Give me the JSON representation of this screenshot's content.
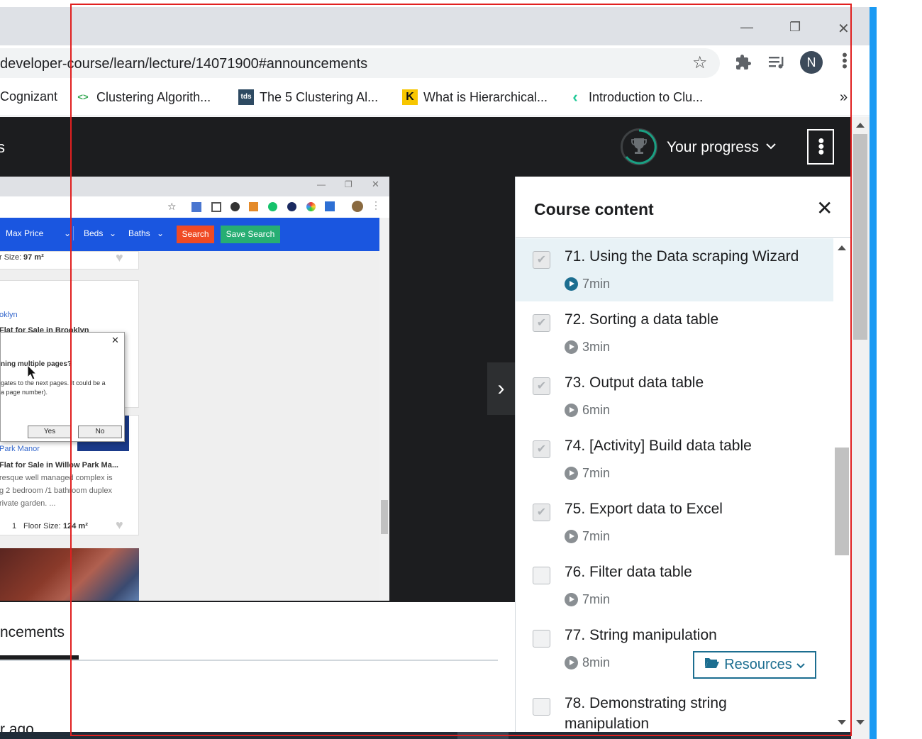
{
  "browser": {
    "url": "developer-course/learn/lecture/14071900#announcements",
    "profile_initial": "N",
    "bookmarks": [
      {
        "icon": "folder-icon",
        "label": "Cognizant"
      },
      {
        "icon": "code-icon",
        "label": "Clustering Algorith..."
      },
      {
        "icon": "tds-icon",
        "icon_text": "tds",
        "label": "The 5 Clustering Al..."
      },
      {
        "icon": "k-icon",
        "icon_text": "K",
        "label": "What is Hierarchical..."
      },
      {
        "icon": "chevron-logo-icon",
        "label": "Introduction to Clu..."
      }
    ],
    "more_bookmarks": "»"
  },
  "header": {
    "left_fragment": "s",
    "progress_label": "Your progress"
  },
  "video": {
    "nav_items": [
      "Max Price",
      "Beds",
      "Baths"
    ],
    "search_label": "Search",
    "save_search_label": "Save Search",
    "card1_size_label": "r Size:",
    "card1_size_value": "97 m²",
    "card2_location": "oklyn",
    "card2_title": "Flat for Sale in Brooklyn",
    "dialog_question": "ning multiple pages?",
    "dialog_body_1": "gates to the next pages. It could be a",
    "dialog_body_2": "a page number).",
    "dialog_yes": "Yes",
    "dialog_no": "No",
    "card3_location": "Park Manor",
    "card3_title": "Flat for Sale in Willow Park Ma...",
    "card3_desc_1": "resque well managed complex is",
    "card3_desc_2": "g 2 bedroom /1 bathroom duplex",
    "card3_desc_3": "rivate garden. ...",
    "card3_baths": "1",
    "card3_size_label": "Floor Size:",
    "card3_size_value": "124 m²"
  },
  "tabs": {
    "announcements_label": "ncements",
    "ago_text": "r ago"
  },
  "sidebar": {
    "title": "Course content",
    "resources_label": "Resources",
    "lectures": [
      {
        "title": "71. Using the Data scraping Wizard",
        "duration": "7min",
        "completed": true,
        "active": true
      },
      {
        "title": "72. Sorting a data table",
        "duration": "3min",
        "completed": true,
        "active": false
      },
      {
        "title": "73. Output data table",
        "duration": "6min",
        "completed": true,
        "active": false
      },
      {
        "title": "74. [Activity] Build data table",
        "duration": "7min",
        "completed": true,
        "active": false
      },
      {
        "title": "75. Export data to Excel",
        "duration": "7min",
        "completed": true,
        "active": false
      },
      {
        "title": "76. Filter data table",
        "duration": "7min",
        "completed": false,
        "active": false
      },
      {
        "title": "77. String manipulation",
        "duration": "8min",
        "completed": false,
        "active": false
      },
      {
        "title": "78. Demonstrating string",
        "title_line2": "manipulation",
        "duration": "",
        "completed": false,
        "active": false
      }
    ]
  },
  "colors": {
    "accent": "#1c6e90",
    "header_bg": "#1c1d1f",
    "active_row": "#e8f2f6",
    "annotation_box": "#e02020"
  }
}
